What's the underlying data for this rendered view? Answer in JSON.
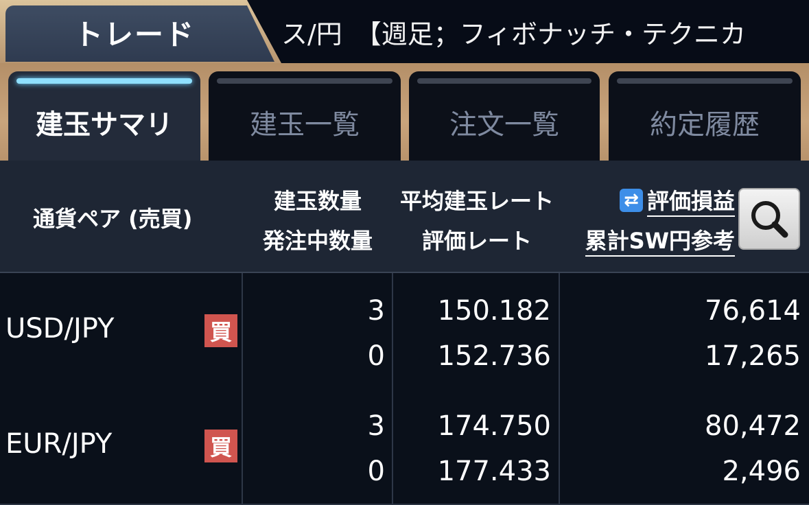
{
  "header": {
    "trade_label": "トレード",
    "ticker_text": "ス/円　【週足；フィボナッチ・テクニカ"
  },
  "tabs": [
    {
      "label": "建玉サマリ",
      "active": true
    },
    {
      "label": "建玉一覧",
      "active": false
    },
    {
      "label": "注文一覧",
      "active": false
    },
    {
      "label": "約定履歴",
      "active": false
    }
  ],
  "columns": {
    "pair": "通貨ペア (売買)",
    "qty_line1": "建玉数量",
    "qty_line2": "発注中数量",
    "rate_line1": "平均建玉レート",
    "rate_line2": "評価レート",
    "pl_line1": "評価損益",
    "pl_line2": "累計SW円参考"
  },
  "icons": {
    "swap": "swap-arrows-icon",
    "search": "magnifier-icon"
  },
  "rows": [
    {
      "pair": "USD/JPY",
      "side": "買",
      "qty": "3",
      "pending_qty": "0",
      "avg_rate": "150.182",
      "eval_rate": "152.736",
      "eval_pl": "76,614",
      "swap_total": "17,265"
    },
    {
      "pair": "EUR/JPY",
      "side": "買",
      "qty": "3",
      "pending_qty": "0",
      "avg_rate": "174.750",
      "eval_rate": "177.433",
      "eval_pl": "80,472",
      "swap_total": "2,496"
    }
  ],
  "colors": {
    "accent_gold": "#c9a47c",
    "active_indicator": "#8fe0ff",
    "buy_badge": "#d0554f",
    "swap_icon": "#3d8ee8"
  }
}
